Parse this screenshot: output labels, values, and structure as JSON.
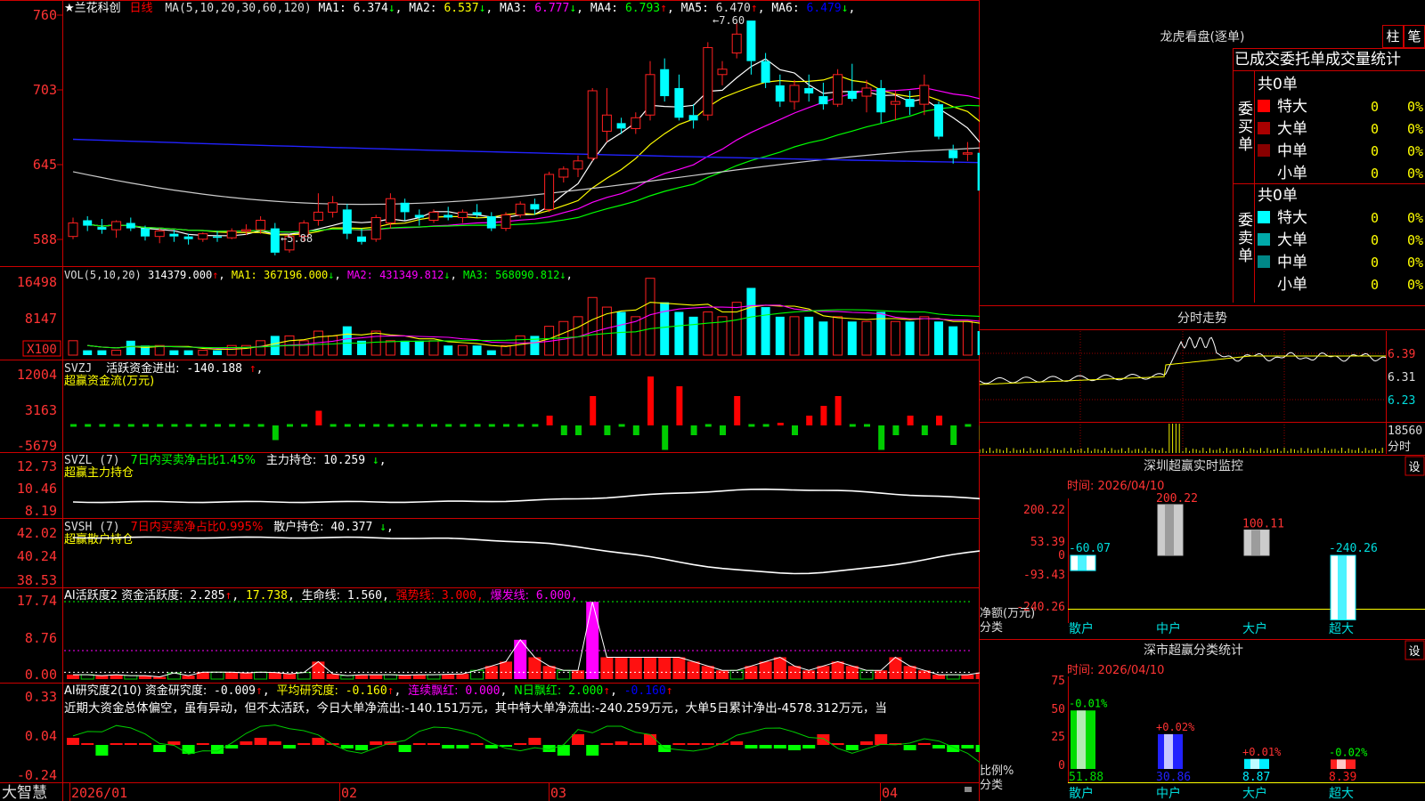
{
  "stock": {
    "title": "★兰花科创",
    "period": "日线"
  },
  "ma_line": {
    "label": "MA(5,10,20,30,60,120)",
    "items": [
      {
        "name": "MA1:",
        "value": "6.374",
        "arrow": "↓",
        "color": "#ffffff"
      },
      {
        "name": "MA2:",
        "value": "6.537",
        "arrow": "↓",
        "color": "#ffff00"
      },
      {
        "name": "MA3:",
        "value": "6.777",
        "arrow": "↓",
        "color": "#ff00ff"
      },
      {
        "name": "MA4:",
        "value": "6.793",
        "arrow": "↑",
        "color": "#00ff00"
      },
      {
        "name": "MA5:",
        "value": "6.470",
        "arrow": "↑",
        "color": "#dddddd"
      },
      {
        "name": "MA6:",
        "value": "6.479",
        "arrow": "↓",
        "color": "#0000ff"
      }
    ]
  },
  "vol_line": {
    "label": "VOL(5,10,20)",
    "items": [
      {
        "name": "",
        "value": "314379.000",
        "arrow": "↑",
        "color": "#ffffff"
      },
      {
        "name": "MA1:",
        "value": "367196.000",
        "arrow": "↓",
        "color": "#ffff00"
      },
      {
        "name": "MA2:",
        "value": "431349.812",
        "arrow": "↓",
        "color": "#ff00ff"
      },
      {
        "name": "MA3:",
        "value": "568090.812",
        "arrow": "↓",
        "color": "#00ff00"
      }
    ]
  },
  "svzj_line": {
    "code": "SVZJ",
    "label": "活跃资金进出:",
    "value": "-140.188",
    "arrow": "↑",
    "sub": "超赢资金流(万元)"
  },
  "svzl_line": {
    "code": "SVZL (7)",
    "pct_label": "7日内买卖净占比1.45%",
    "label": "主力持仓:",
    "value": "10.259",
    "arrow": "↓",
    "sub": "超赢主力持仓"
  },
  "svsh_line": {
    "code": "SVSH (7)",
    "pct_label": "7日内买卖净占比0.995%",
    "label": "散户持仓:",
    "value": "40.377",
    "arrow": "↓",
    "sub": "超赢散户持仓"
  },
  "ai1_line": {
    "label": "AI活跃度2 资金活跃度:",
    "v1": "2.285",
    "v2": "17.738",
    "life_label": "生命线:",
    "life": "1.560",
    "strong_label": "强势线:",
    "strong": "3.000",
    "burst_label": "爆发线:",
    "burst": "6.000"
  },
  "ai2_line": {
    "label": "AI研究度2(10) 资金研究度:",
    "v1": "-0.009",
    "avg_label": "平均研究度:",
    "avg": "-0.160",
    "lian_label": "连续飘红:",
    "lian": "0.000",
    "n_label": "N日飘红:",
    "n": "2.000",
    "last": "-0.160"
  },
  "ai2_text": "近期大资金总体偏空，虽有异动，但不太活跃，今日大单净流出:-140.151万元，其中特大单净流出:-240.259万元，大单5日累计净出-4578.312万元，当",
  "axes": {
    "price": [
      "760",
      "703",
      "645",
      "588"
    ],
    "vol": [
      "16498",
      "8147",
      "X100"
    ],
    "svzj": [
      "12004",
      "3163",
      "-5679"
    ],
    "svzl": [
      "12.73",
      "10.46",
      "8.19"
    ],
    "svsh": [
      "42.02",
      "40.24",
      "38.53"
    ],
    "ai1": [
      "17.74",
      "8.76",
      "0.00"
    ],
    "ai2": [
      "0.33",
      "0.04",
      "-0.24"
    ]
  },
  "dates": [
    "2026/01",
    "02",
    "03",
    "04"
  ],
  "logo": "大智慧",
  "annotations": {
    "high": "7.60",
    "low": "5.88"
  },
  "right": {
    "lhb_title": "龙虎看盘(逐单)",
    "btn1": "柱",
    "btn2": "笔",
    "lhb_header": "已成交委托单成交量统计",
    "buy": {
      "side": "委买单",
      "total": "共0单",
      "rows": [
        {
          "label": "特大",
          "v": "0",
          "p": "0%",
          "color": "#ff0000"
        },
        {
          "label": "大单",
          "v": "0",
          "p": "0%",
          "color": "#aa0000"
        },
        {
          "label": "中单",
          "v": "0",
          "p": "0%",
          "color": "#880000"
        },
        {
          "label": "小单",
          "v": "0",
          "p": "0%",
          "color": "#000000"
        }
      ]
    },
    "sell": {
      "side": "委卖单",
      "total": "共0单",
      "rows": [
        {
          "label": "特大",
          "v": "0",
          "p": "0%",
          "color": "#00ffff"
        },
        {
          "label": "大单",
          "v": "0",
          "p": "0%",
          "color": "#00aaaa"
        },
        {
          "label": "中单",
          "v": "0",
          "p": "0%",
          "color": "#008888"
        },
        {
          "label": "小单",
          "v": "0",
          "p": "0%",
          "color": "#000000"
        }
      ]
    },
    "fs_title": "分时走势",
    "fs_axis": [
      "6.39",
      "6.31",
      "6.23",
      "18560",
      "分时"
    ],
    "sz_title": "深圳超赢实时监控",
    "sz_settings": "设",
    "sz_time": "时间: 2026/04/10",
    "sz_axis": [
      "200.22",
      "53.39",
      "0",
      "-93.43",
      "-240.26"
    ],
    "sz_unit": "净额(万元)",
    "sz_group": "分类",
    "sz_cats": [
      "散户",
      "中户",
      "大户",
      "超大"
    ],
    "sz_values": [
      -60.07,
      200.22,
      100.11,
      -240.26
    ],
    "sz_labels": [
      "-60.07",
      "200.22",
      "100.11",
      "-240.26"
    ],
    "fl_title": "深市超赢分类统计",
    "fl_settings": "设",
    "fl_time": "时间: 2026/04/10",
    "fl_axis": [
      "75",
      "50",
      "25",
      "0"
    ],
    "fl_unit": "比例%",
    "fl_group": "分类",
    "fl_cats": [
      "散户",
      "中户",
      "大户",
      "超大"
    ],
    "fl_values": [
      51.88,
      30.86,
      8.87,
      8.39
    ],
    "fl_labels": [
      "51.88",
      "30.86",
      "8.87",
      "8.39"
    ],
    "fl_changes": [
      "-0.01%",
      "+0.02%",
      "+0.01%",
      "-0.02%"
    ]
  },
  "chart_data": [
    {
      "type": "candlestick",
      "title": "兰花科创 日线",
      "price_range": [
        5.8,
        7.7
      ],
      "x_ticks": [
        "2026/01",
        "02",
        "03",
        "04"
      ],
      "ohlc": [
        [
          6.0,
          6.14,
          5.98,
          6.1
        ],
        [
          6.12,
          6.15,
          6.04,
          6.08
        ],
        [
          6.07,
          6.13,
          6.02,
          6.05
        ],
        [
          6.05,
          6.12,
          5.99,
          6.11
        ],
        [
          6.1,
          6.14,
          6.04,
          6.06
        ],
        [
          6.06,
          6.08,
          5.97,
          6.0
        ],
        [
          6.0,
          6.06,
          5.95,
          6.04
        ],
        [
          6.02,
          6.05,
          5.96,
          6.0
        ],
        [
          6.0,
          6.02,
          5.94,
          5.98
        ],
        [
          5.98,
          6.03,
          5.96,
          6.02
        ],
        [
          6.0,
          6.04,
          5.96,
          5.99
        ],
        [
          5.99,
          6.06,
          5.98,
          6.04
        ],
        [
          6.04,
          6.09,
          6.01,
          6.05
        ],
        [
          6.05,
          6.15,
          6.02,
          6.12
        ],
        [
          6.06,
          6.1,
          5.86,
          5.88
        ],
        [
          5.9,
          6.02,
          5.88,
          6.0
        ],
        [
          6.0,
          6.12,
          5.96,
          6.1
        ],
        [
          6.12,
          6.32,
          6.08,
          6.18
        ],
        [
          6.18,
          6.3,
          6.14,
          6.25
        ],
        [
          6.2,
          6.24,
          5.98,
          6.02
        ],
        [
          6.0,
          6.06,
          5.94,
          5.96
        ],
        [
          5.98,
          6.16,
          5.96,
          6.14
        ],
        [
          6.1,
          6.32,
          6.06,
          6.28
        ],
        [
          6.25,
          6.28,
          6.12,
          6.18
        ],
        [
          6.16,
          6.2,
          6.08,
          6.14
        ],
        [
          6.12,
          6.2,
          6.1,
          6.18
        ],
        [
          6.16,
          6.22,
          6.12,
          6.14
        ],
        [
          6.14,
          6.2,
          6.1,
          6.18
        ],
        [
          6.18,
          6.24,
          6.14,
          6.16
        ],
        [
          6.15,
          6.18,
          6.04,
          6.06
        ],
        [
          6.06,
          6.18,
          6.04,
          6.16
        ],
        [
          6.16,
          6.26,
          6.14,
          6.24
        ],
        [
          6.24,
          6.28,
          6.16,
          6.2
        ],
        [
          6.2,
          6.48,
          6.18,
          6.46
        ],
        [
          6.44,
          6.52,
          6.4,
          6.5
        ],
        [
          6.5,
          6.6,
          6.44,
          6.56
        ],
        [
          6.58,
          7.1,
          6.56,
          7.08
        ],
        [
          6.78,
          7.1,
          6.7,
          6.9
        ],
        [
          6.84,
          6.88,
          6.76,
          6.8
        ],
        [
          6.8,
          6.92,
          6.76,
          6.88
        ],
        [
          6.9,
          7.3,
          6.86,
          7.2
        ],
        [
          7.24,
          7.32,
          7.0,
          7.04
        ],
        [
          7.1,
          7.2,
          6.86,
          6.88
        ],
        [
          6.9,
          6.98,
          6.8,
          6.86
        ],
        [
          6.9,
          7.44,
          6.86,
          7.4
        ],
        [
          7.2,
          7.3,
          7.12,
          7.24
        ],
        [
          7.36,
          7.58,
          7.32,
          7.5
        ],
        [
          7.6,
          7.6,
          7.2,
          7.3
        ],
        [
          7.3,
          7.36,
          7.1,
          7.14
        ],
        [
          7.12,
          7.2,
          6.96,
          7.0
        ],
        [
          7.0,
          7.16,
          6.94,
          7.12
        ],
        [
          7.1,
          7.2,
          7.0,
          7.06
        ],
        [
          7.04,
          7.14,
          6.94,
          6.98
        ],
        [
          6.98,
          7.24,
          6.96,
          7.2
        ],
        [
          7.08,
          7.28,
          7.0,
          7.02
        ],
        [
          7.04,
          7.16,
          6.92,
          7.1
        ],
        [
          7.1,
          7.16,
          6.84,
          6.92
        ],
        [
          6.98,
          7.08,
          6.86,
          7.0
        ],
        [
          7.02,
          7.08,
          6.9,
          6.96
        ],
        [
          6.98,
          7.2,
          6.9,
          7.12
        ],
        [
          6.98,
          7.0,
          6.72,
          6.74
        ],
        [
          6.64,
          6.68,
          6.54,
          6.58
        ],
        [
          6.62,
          6.7,
          6.56,
          6.62
        ],
        [
          6.62,
          6.64,
          6.32,
          6.34
        ],
        [
          6.36,
          6.66,
          6.34,
          6.62
        ],
        [
          6.58,
          6.64,
          6.32,
          6.38
        ],
        [
          6.42,
          6.54,
          6.38,
          6.48
        ],
        [
          6.46,
          6.52,
          6.38,
          6.4
        ]
      ],
      "ma_labels": [
        "MA1",
        "MA2",
        "MA3",
        "MA4",
        "MA5",
        "MA6"
      ]
    },
    {
      "type": "bar",
      "title": "VOL",
      "values": [
        3,
        1,
        1,
        1,
        3,
        2,
        2,
        1,
        1,
        1,
        1,
        2,
        2,
        3,
        4,
        4,
        3,
        5,
        4,
        6,
        3,
        5,
        3,
        3,
        3,
        3,
        2,
        2,
        2,
        1,
        2,
        4,
        4,
        6,
        7,
        8,
        12,
        10,
        9,
        8,
        16,
        11,
        9,
        8,
        9,
        8,
        11,
        14,
        10,
        8,
        8,
        8,
        7,
        8,
        7,
        7,
        9,
        7,
        7,
        8,
        7,
        6,
        7,
        5,
        5,
        5,
        4,
        3
      ]
    },
    {
      "type": "bar",
      "title": "超赢资金流",
      "values": [
        -1,
        -1,
        -1,
        -1,
        -1,
        -1,
        -1,
        -1,
        -1,
        -1,
        -1,
        -1,
        -1,
        -1,
        -3,
        -1,
        -1,
        3,
        -1,
        -1,
        -1,
        -1,
        -1,
        -1,
        -1,
        -1,
        -1,
        -1,
        -1,
        -1,
        -1,
        -1,
        -1,
        2,
        -2,
        -2,
        6,
        -2,
        -1,
        -2,
        10,
        -5,
        8,
        -2,
        -1,
        -2,
        6,
        -1,
        -1,
        1,
        -2,
        2,
        4,
        6,
        -1,
        -1,
        -5,
        -2,
        2,
        -2,
        2,
        -4,
        -1,
        -3,
        -2,
        -3,
        -1,
        -1
      ],
      "range": [
        -5679,
        12004
      ]
    },
    {
      "type": "line",
      "title": "超赢主力持仓",
      "range": [
        8.19,
        12.73
      ],
      "trend": "mostly flat around 9.4, spike to 11.2 in late March, ends 10.26"
    },
    {
      "type": "line",
      "title": "超赢散户持仓",
      "range": [
        38.53,
        42.02
      ],
      "trend": "high around 41.6, dips to 39.0 in late March, ends 40.38"
    },
    {
      "type": "bar",
      "title": "AI活跃度2",
      "values": [
        1,
        1,
        0.8,
        1,
        0.8,
        0.8,
        0.5,
        1.4,
        0.8,
        1.6,
        1.6,
        1.6,
        1.4,
        1.6,
        1.5,
        1.2,
        1.5,
        4,
        1.2,
        0.8,
        1,
        1,
        1,
        0.9,
        1,
        1,
        1.1,
        1.2,
        2,
        3,
        4,
        9,
        5,
        3,
        2,
        2,
        17.7,
        5,
        5,
        5,
        5,
        5,
        5,
        4,
        3,
        2,
        2,
        3,
        4,
        5,
        3,
        2,
        3,
        4,
        3,
        2,
        2,
        5,
        3,
        2,
        1,
        1,
        1,
        1.5,
        2,
        2,
        1.5,
        1.2
      ],
      "range": [
        0,
        17.74
      ]
    },
    {
      "type": "bar",
      "title": "AI研究度2",
      "values": [
        0.04,
        0.01,
        -0.06,
        0.01,
        0.01,
        0,
        -0.04,
        0.02,
        -0.05,
        0,
        -0.05,
        -0.02,
        0.02,
        0.04,
        0.02,
        -0.02,
        0.01,
        0.04,
        0,
        -0.02,
        -0.03,
        0.02,
        0.02,
        -0.04,
        0,
        0,
        -0.02,
        -0.02,
        0,
        -0.02,
        -0.01,
        0,
        0.04,
        -0.04,
        -0.06,
        0.06,
        -0.06,
        0,
        0.02,
        0,
        0.06,
        -0.04,
        0,
        0,
        0,
        0,
        0.02,
        -0.02,
        -0.02,
        -0.02,
        -0.03,
        -0.02,
        0.06,
        0,
        -0.03,
        0.02,
        0.06,
        0,
        -0.03,
        0,
        -0.02,
        -0.04,
        -0.02,
        -0.04,
        0,
        -0.03,
        -0.05,
        -0.06
      ],
      "range": [
        -0.24,
        0.33
      ]
    },
    {
      "type": "bar",
      "title": "深圳超赢实时监控",
      "categories": [
        "散户",
        "中户",
        "大户",
        "超大"
      ],
      "values": [
        -60.07,
        200.22,
        100.11,
        -240.26
      ],
      "ylim": [
        -240.26,
        200.22
      ]
    },
    {
      "type": "bar",
      "title": "深市超赢分类统计",
      "categories": [
        "散户",
        "中户",
        "大户",
        "超大"
      ],
      "values": [
        51.88,
        30.86,
        8.87,
        8.39
      ],
      "ylim": [
        0,
        75
      ]
    }
  ]
}
